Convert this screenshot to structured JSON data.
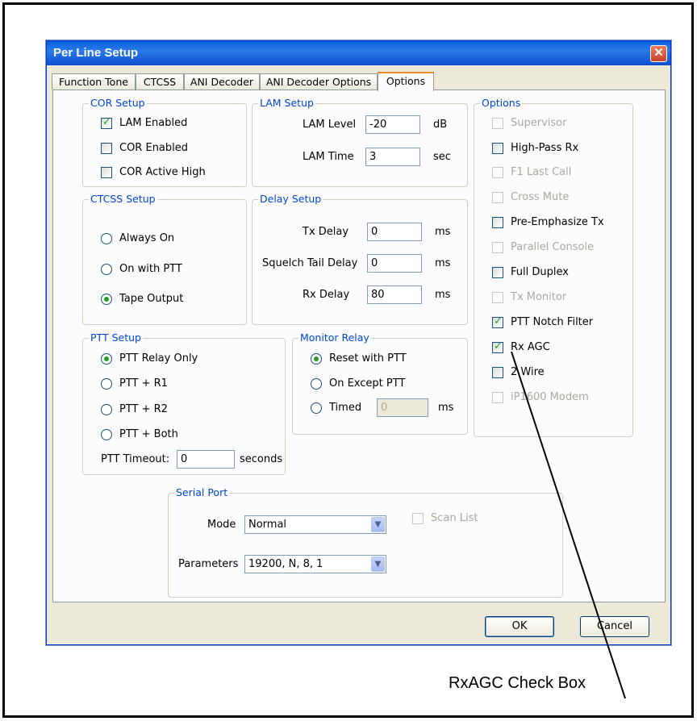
{
  "window": {
    "title": "Per Line Setup",
    "close_glyph": "✕"
  },
  "tabs": [
    "Function Tone",
    "CTCSS",
    "ANI Decoder",
    "ANI Decoder Options",
    "Options"
  ],
  "active_tab": "Options",
  "cor_setup": {
    "title": "COR Setup",
    "items": [
      {
        "label": "LAM Enabled",
        "checked": true
      },
      {
        "label": "COR Enabled",
        "checked": false
      },
      {
        "label": "COR Active High",
        "checked": false
      }
    ]
  },
  "lam_setup": {
    "title": "LAM Setup",
    "level_label": "LAM Level",
    "level_value": "-20",
    "level_unit": "dB",
    "time_label": "LAM Time",
    "time_value": "3",
    "time_unit": "sec"
  },
  "ctcss_setup": {
    "title": "CTCSS Setup",
    "options": [
      "Always On",
      "On with PTT",
      "Tape Output"
    ],
    "selected": "Tape Output"
  },
  "delay_setup": {
    "title": "Delay Setup",
    "tx_label": "Tx Delay",
    "tx_value": "0",
    "tx_unit": "ms",
    "squelch_label": "Squelch Tail Delay",
    "squelch_value": "0",
    "squelch_unit": "ms",
    "rx_label": "Rx Delay",
    "rx_value": "80",
    "rx_unit": "ms"
  },
  "ptt_setup": {
    "title": "PTT Setup",
    "options": [
      "PTT Relay Only",
      "PTT + R1",
      "PTT + R2",
      "PTT + Both"
    ],
    "selected": "PTT Relay Only",
    "timeout_label": "PTT Timeout:",
    "timeout_value": "0",
    "timeout_unit": "seconds"
  },
  "monitor_relay": {
    "title": "Monitor Relay",
    "options": [
      "Reset with PTT",
      "On Except PTT",
      "Timed"
    ],
    "selected": "Reset with PTT",
    "timed_value": "0",
    "timed_unit": "ms"
  },
  "options": {
    "title": "Options",
    "items": [
      {
        "label": "Supervisor",
        "checked": false,
        "enabled": false
      },
      {
        "label": "High-Pass Rx",
        "checked": false,
        "enabled": true
      },
      {
        "label": "F1 Last Call",
        "checked": false,
        "enabled": false
      },
      {
        "label": "Cross Mute",
        "checked": false,
        "enabled": false
      },
      {
        "label": "Pre-Emphasize Tx",
        "checked": false,
        "enabled": true
      },
      {
        "label": "Parallel Console",
        "checked": false,
        "enabled": false
      },
      {
        "label": "Full Duplex",
        "checked": false,
        "enabled": true
      },
      {
        "label": "Tx Monitor",
        "checked": false,
        "enabled": false
      },
      {
        "label": "PTT Notch Filter",
        "checked": true,
        "enabled": true
      },
      {
        "label": "Rx AGC",
        "checked": true,
        "enabled": true
      },
      {
        "label": "2 Wire",
        "checked": false,
        "enabled": true
      },
      {
        "label": "iP1600 Modem",
        "checked": false,
        "enabled": false
      }
    ]
  },
  "serial_port": {
    "title": "Serial Port",
    "mode_label": "Mode",
    "mode_value": "Normal",
    "scan_list_label": "Scan List",
    "parameters_label": "Parameters",
    "parameters_value": "19200, N, 8, 1"
  },
  "buttons": {
    "ok": "OK",
    "cancel": "Cancel"
  },
  "callout": {
    "text": "RxAGC Check Box"
  },
  "colors": {
    "title_bar": "#0a5fdc",
    "group_title": "#0046d5",
    "check_mark": "#21a121",
    "dialog_bg": "#ece9d8"
  },
  "icons": {
    "dropdown": "chevron-down-icon",
    "close": "close-icon"
  }
}
